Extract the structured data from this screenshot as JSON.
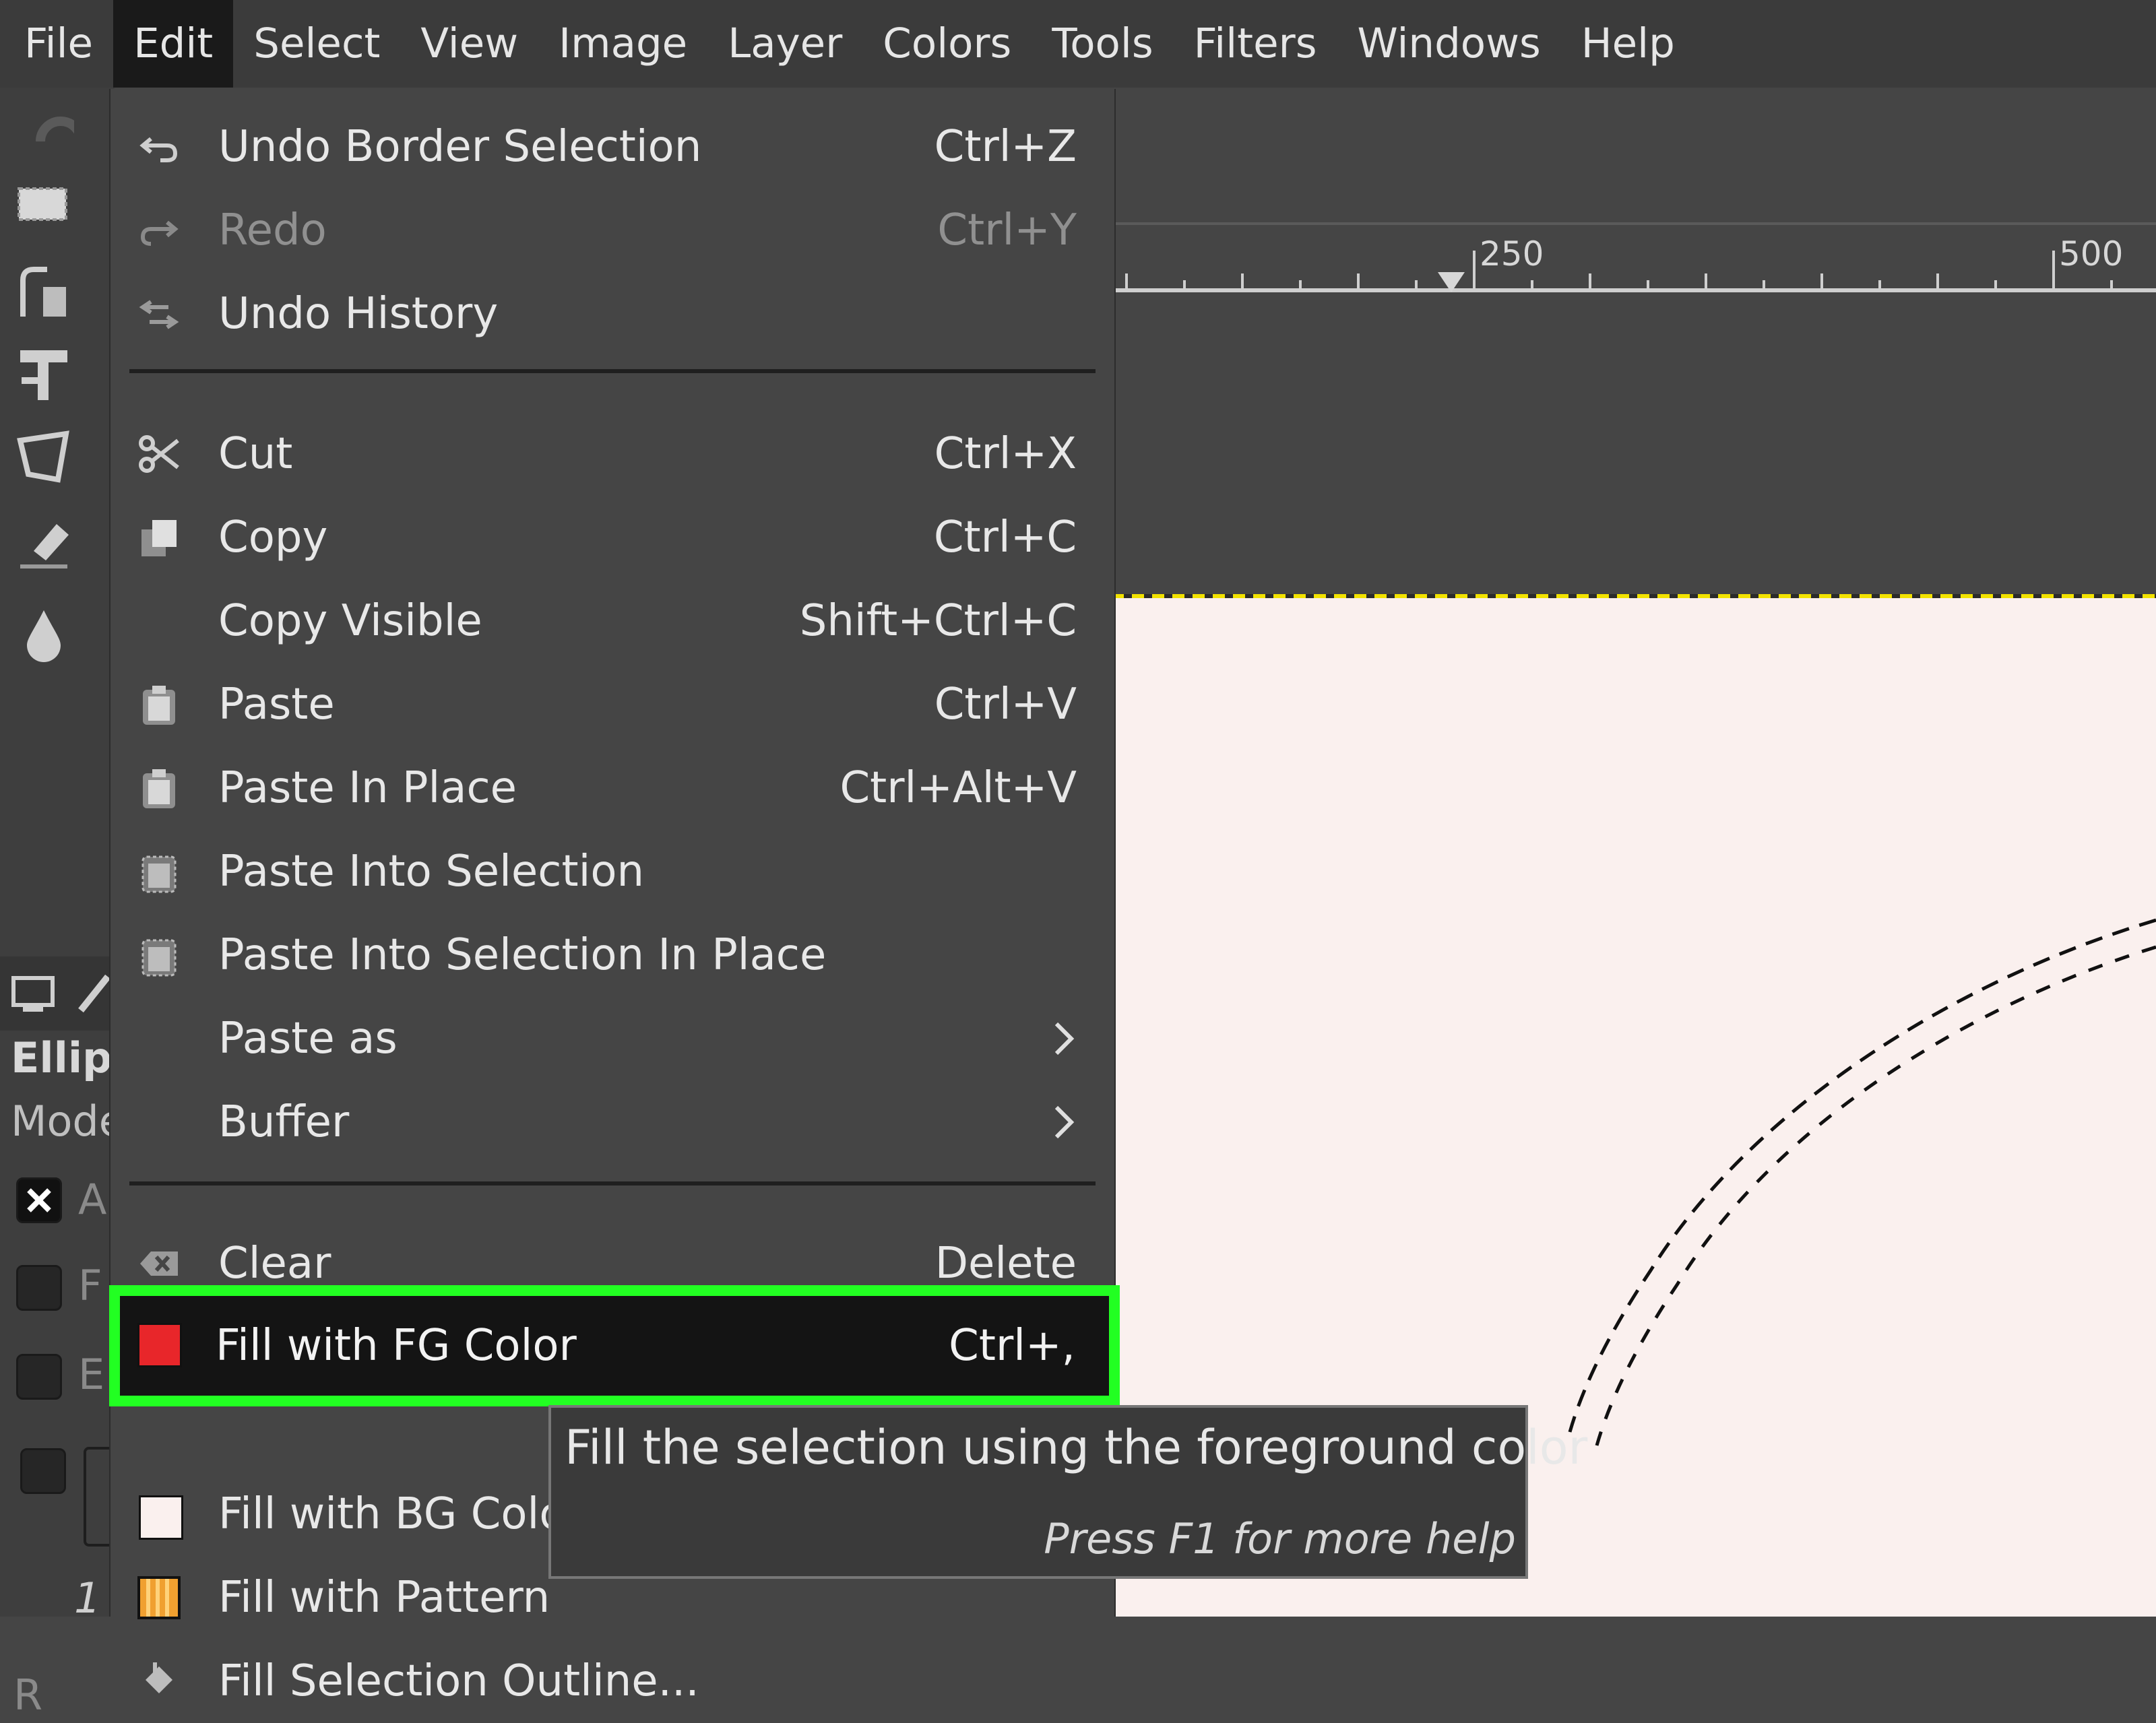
{
  "menubar": {
    "items": [
      {
        "label": "File"
      },
      {
        "label": "Edit",
        "active": true
      },
      {
        "label": "Select"
      },
      {
        "label": "View"
      },
      {
        "label": "Image"
      },
      {
        "label": "Layer"
      },
      {
        "label": "Colors"
      },
      {
        "label": "Tools"
      },
      {
        "label": "Filters"
      },
      {
        "label": "Windows"
      },
      {
        "label": "Help"
      }
    ]
  },
  "tool_options": {
    "tool_name": "Ellip",
    "mode_label": "Mode",
    "check_a": "A",
    "check_f": "F",
    "check_e": "E",
    "value_fragment": "1",
    "bottom_fragment": "R"
  },
  "ruler": {
    "label_250": "250",
    "label_500": "500"
  },
  "edit_menu": {
    "undo": {
      "label": "Undo Border Selection",
      "shortcut": "Ctrl+Z",
      "icon": "undo-icon"
    },
    "redo": {
      "label": "Redo",
      "shortcut": "Ctrl+Y",
      "icon": "redo-icon",
      "disabled": true
    },
    "undo_history": {
      "label": "Undo History",
      "icon": "undo-history-icon"
    },
    "cut": {
      "label": "Cut",
      "shortcut": "Ctrl+X",
      "icon": "scissors-icon"
    },
    "copy": {
      "label": "Copy",
      "shortcut": "Ctrl+C",
      "icon": "copy-icon"
    },
    "copy_visible": {
      "label": "Copy Visible",
      "shortcut": "Shift+Ctrl+C"
    },
    "paste": {
      "label": "Paste",
      "shortcut": "Ctrl+V",
      "icon": "paste-icon"
    },
    "paste_in_place": {
      "label": "Paste In Place",
      "shortcut": "Ctrl+Alt+V",
      "icon": "paste-icon"
    },
    "paste_into_selection": {
      "label": "Paste Into Selection",
      "icon": "paste-into-icon"
    },
    "paste_into_selection_in_place": {
      "label": "Paste Into Selection In Place",
      "icon": "paste-into-icon"
    },
    "paste_as": {
      "label": "Paste as",
      "icon": "chevron-right-icon"
    },
    "buffer": {
      "label": "Buffer",
      "icon": "chevron-right-icon"
    },
    "clear": {
      "label": "Clear",
      "shortcut": "Delete",
      "icon": "clear-icon"
    },
    "fill_fg": {
      "label": "Fill with FG Color",
      "shortcut": "Ctrl+,",
      "swatch_color": "#e8262a",
      "highlighted": true
    },
    "fill_bg": {
      "label": "Fill with BG Color",
      "swatch_color": "#faf0ee"
    },
    "fill_pattern": {
      "label": "Fill with Pattern",
      "icon": "pattern-icon"
    },
    "fill_outline": {
      "label": "Fill Selection Outline..."
    }
  },
  "tooltip": {
    "text": "Fill the selection using the foreground color",
    "help": "Press F1 for more help"
  },
  "colors": {
    "highlight_border": "#22ff22",
    "fg_swatch": "#e8262a",
    "bg_swatch": "#faf0ee",
    "canvas_bg": "#faf0ee"
  }
}
